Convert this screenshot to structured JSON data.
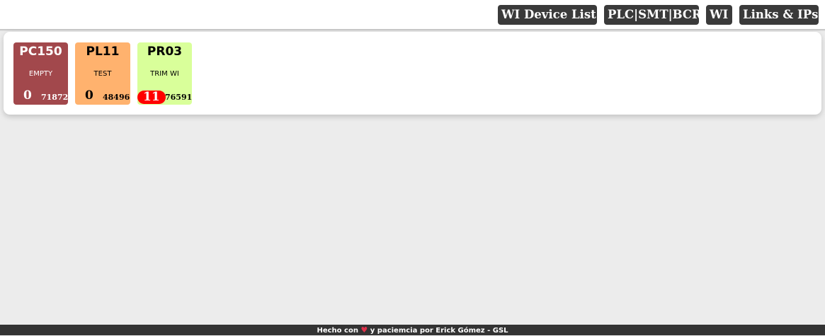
{
  "nav": {
    "wi_device_list": "WI Device List",
    "plc_smt_bcr": "PLC|SMT|BCR",
    "wi": "WI",
    "links_ips": "Links & IPs"
  },
  "devices": [
    {
      "name": "PC150",
      "status": "EMPTY",
      "count": "0",
      "serial": "71872",
      "color": "#a2484c"
    },
    {
      "name": "PL11",
      "status": "TEST",
      "count": "0",
      "serial": "48496",
      "color": "#ffb26e"
    },
    {
      "name": "PR03",
      "status": "TRIM WI",
      "count": "11",
      "serial": "76591",
      "color": "#d9ff9a"
    }
  ],
  "footer": {
    "before": "Hecho con",
    "heart": "heart-icon",
    "after": "y paciemcia por Erick Gómez - GSL"
  }
}
